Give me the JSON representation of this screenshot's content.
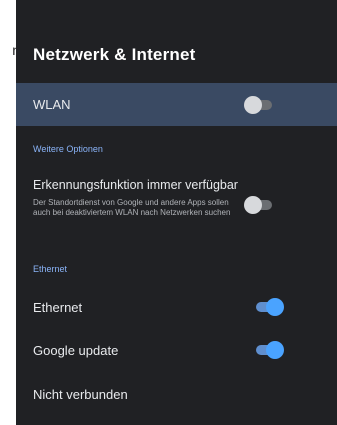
{
  "stray_text": "n",
  "screen": {
    "title": "Netzwerk & Internet"
  },
  "wlan": {
    "label": "WLAN",
    "toggle_on": false
  },
  "section_more": {
    "title": "Weitere Optionen"
  },
  "scanning": {
    "label": "Erkennungsfunktion immer verfügbar",
    "description": "Der Standortdienst von Google und andere Apps sollen auch bei deaktiviertem WLAN nach Netzwerken suchen",
    "toggle_on": false
  },
  "section_ethernet": {
    "title": "Ethernet"
  },
  "ethernet": {
    "label": "Ethernet",
    "toggle_on": true
  },
  "google_update": {
    "label": "Google update",
    "toggle_on": true
  },
  "connection_status": {
    "label": "Nicht verbunden"
  },
  "colors": {
    "background": "#202124",
    "selected_row": "#3a4a63",
    "accent": "#8ab4f8",
    "toggle_on_thumb": "#4aa3ff"
  }
}
